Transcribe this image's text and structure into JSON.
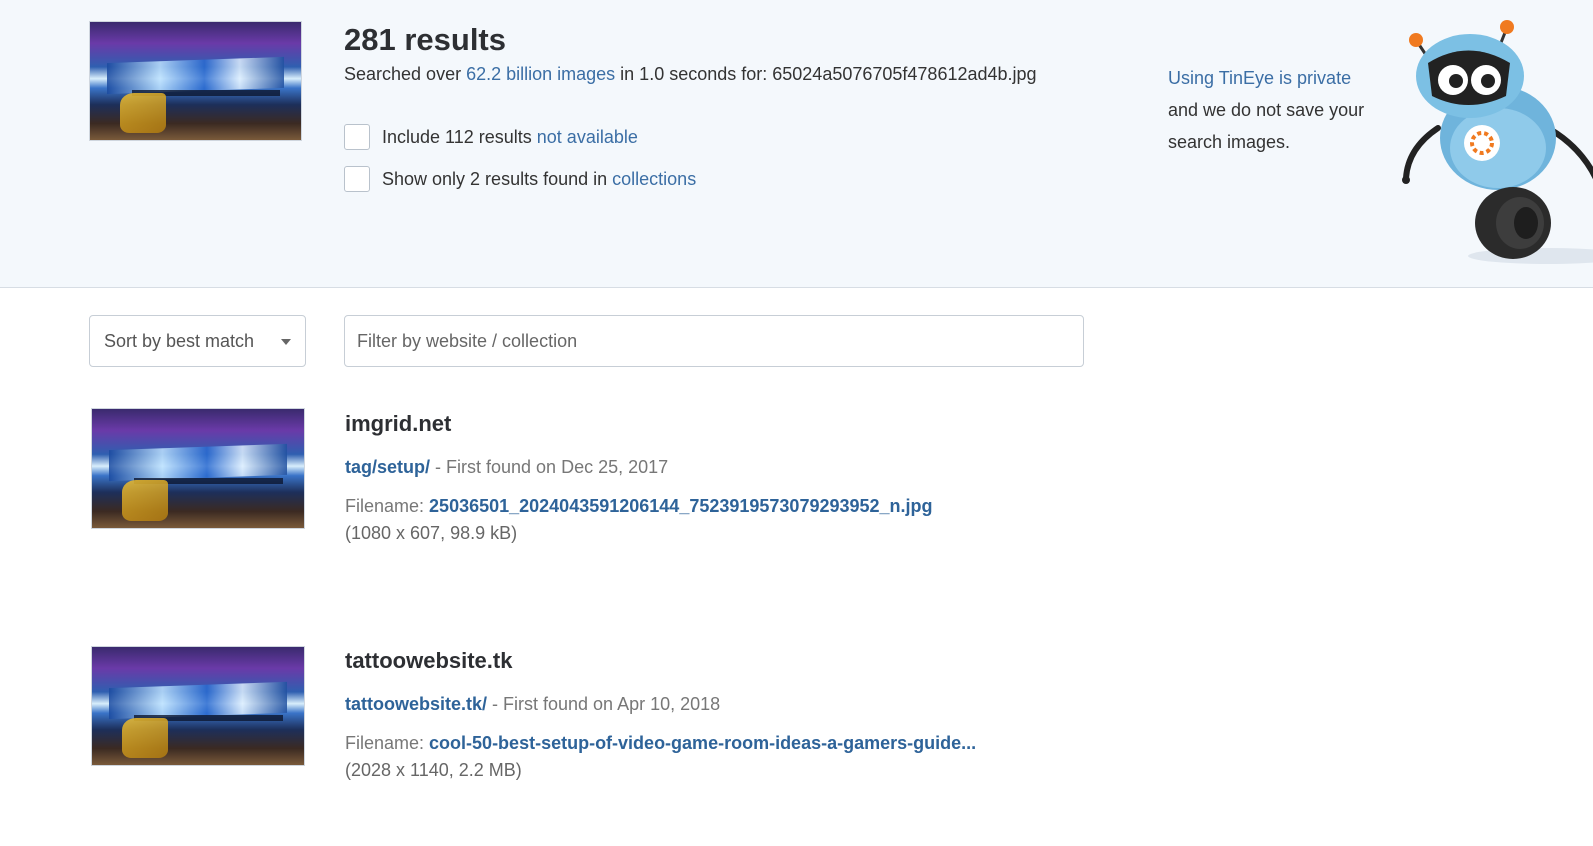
{
  "summary": {
    "count_text": "281 results",
    "searched_prefix": "Searched over ",
    "searched_link": "62.2 billion images",
    "searched_middle": " in 1.0 seconds for: ",
    "query_filename": "65024a5076705f478612ad4b.jpg"
  },
  "options": {
    "include_prefix": "Include 112 results ",
    "include_link": "not available",
    "show_prefix": "Show only 2 results found in ",
    "show_link": "collections"
  },
  "privacy": {
    "link": "Using TinEye is private",
    "text": "and we do not save your search images."
  },
  "controls": {
    "sort_label": "Sort by best match",
    "filter_placeholder": "Filter by website / collection"
  },
  "results": [
    {
      "domain": "imgrid.net",
      "path": "tag/setup/",
      "found": " - First found on Dec 25, 2017",
      "filename_label": "Filename: ",
      "filename": "25036501_2024043591206144_7523919573079293952_n.jpg",
      "dimensions": "(1080 x 607, 98.9 kB)"
    },
    {
      "domain": "tattoowebsite.tk",
      "path": "tattoowebsite.tk/",
      "found": " - First found on Apr 10, 2018",
      "filename_label": "Filename: ",
      "filename": "cool-50-best-setup-of-video-game-room-ideas-a-gamers-guide...",
      "dimensions": "(2028 x 1140, 2.2 MB)"
    }
  ],
  "colors": {
    "header_bg": "#f4f8fc",
    "link": "#3b6ea5",
    "text": "#333333"
  }
}
